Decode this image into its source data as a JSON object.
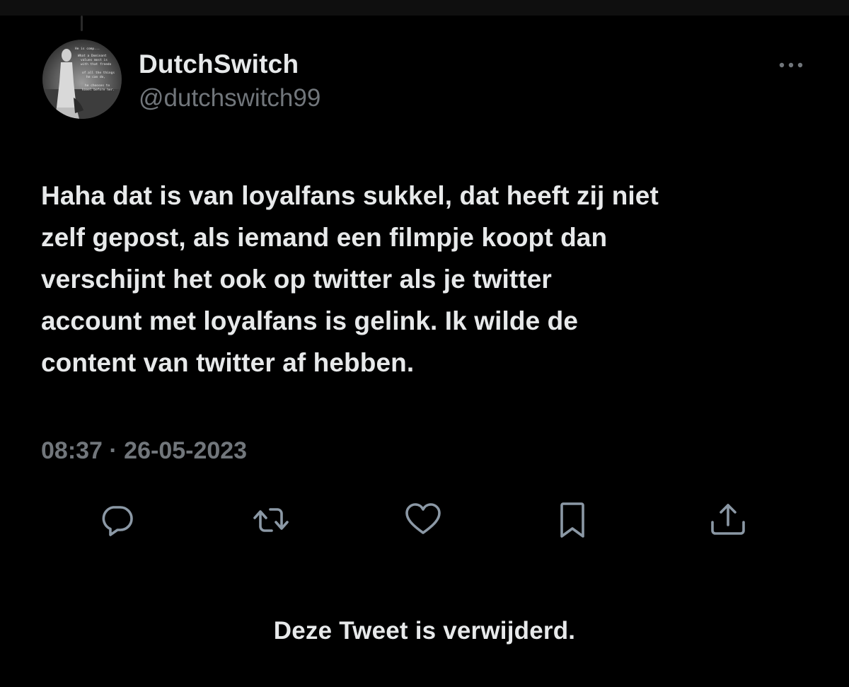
{
  "tweet": {
    "display_name": "DutchSwitch",
    "handle": "@dutchswitch99",
    "text": "Haha dat is van loyalfans sukkel, dat heeft zij niet\nzelf gepost, als iemand een filmpje koopt dan\nverschijnt het ook op twitter als je twitter\naccount met loyalfans is gelink. Ik wilde de\ncontent van twitter af hebben.",
    "timestamp": "08:37 · 26-05-2023"
  },
  "avatar": {
    "text_lines": [
      "He is comp...",
      "What a Dominant",
      "values most is",
      "with that freedo",
      "of all the things",
      "he can do,",
      "he chooses to",
      "kneel before her."
    ]
  },
  "actions": [
    {
      "name": "reply",
      "icon": "reply-icon"
    },
    {
      "name": "retweet",
      "icon": "retweet-icon"
    },
    {
      "name": "like",
      "icon": "heart-icon"
    },
    {
      "name": "bookmark",
      "icon": "bookmark-icon"
    },
    {
      "name": "share",
      "icon": "share-icon"
    }
  ],
  "notice": {
    "text": "Deze Tweet is verwijderd."
  },
  "colors": {
    "background": "#000000",
    "primary_text": "#e7e9ea",
    "secondary_text": "#71767b",
    "icon": "#8b98a5"
  }
}
